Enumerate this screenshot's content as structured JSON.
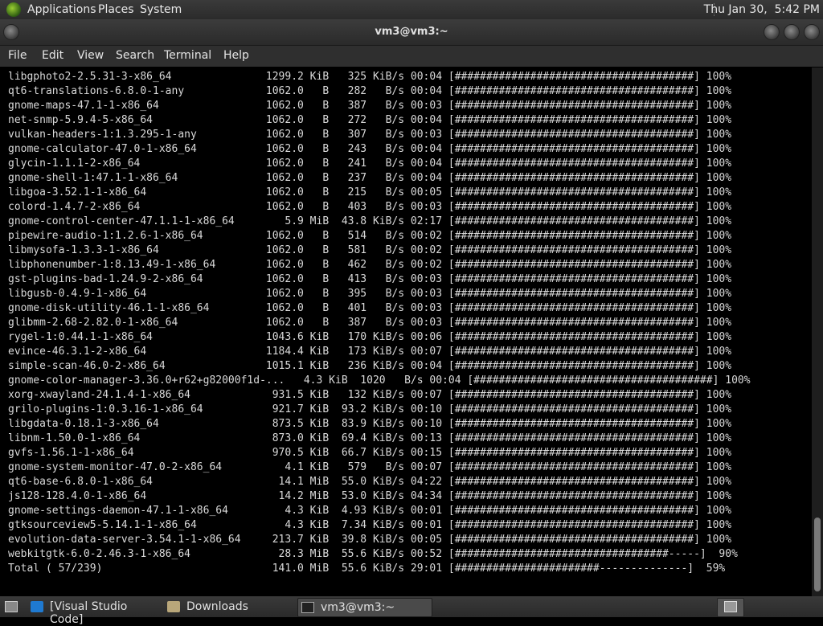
{
  "top_panel": {
    "menus": [
      "Applications",
      "Places",
      "System"
    ],
    "clock": "Thu Jan 30,  5:42 PM"
  },
  "window": {
    "title": "vm3@vm3:~"
  },
  "menubar": [
    "File",
    "Edit",
    "View",
    "Search",
    "Terminal",
    "Help"
  ],
  "terminal_lines": [
    "libgphoto2-2.5.31-3-x86_64               1299.2 KiB   325 KiB/s 00:04 [######################################] 100%",
    "qt6-translations-6.8.0-1-any             1062.0   B   282   B/s 00:04 [######################################] 100%",
    "gnome-maps-47.1-1-x86_64                 1062.0   B   387   B/s 00:03 [######################################] 100%",
    "net-snmp-5.9.4-5-x86_64                  1062.0   B   272   B/s 00:04 [######################################] 100%",
    "vulkan-headers-1:1.3.295-1-any           1062.0   B   307   B/s 00:03 [######################################] 100%",
    "gnome-calculator-47.0-1-x86_64           1062.0   B   243   B/s 00:04 [######################################] 100%",
    "glycin-1.1.1-2-x86_64                    1062.0   B   241   B/s 00:04 [######################################] 100%",
    "gnome-shell-1:47.1-1-x86_64              1062.0   B   237   B/s 00:04 [######################################] 100%",
    "libgoa-3.52.1-1-x86_64                   1062.0   B   215   B/s 00:05 [######################################] 100%",
    "colord-1.4.7-2-x86_64                    1062.0   B   403   B/s 00:03 [######################################] 100%",
    "gnome-control-center-47.1.1-1-x86_64        5.9 MiB  43.8 KiB/s 02:17 [######################################] 100%",
    "pipewire-audio-1:1.2.6-1-x86_64          1062.0   B   514   B/s 00:02 [######################################] 100%",
    "libmysofa-1.3.3-1-x86_64                 1062.0   B   581   B/s 00:02 [######################################] 100%",
    "libphonenumber-1:8.13.49-1-x86_64        1062.0   B   462   B/s 00:02 [######################################] 100%",
    "gst-plugins-bad-1.24.9-2-x86_64          1062.0   B   413   B/s 00:03 [######################################] 100%",
    "libgusb-0.4.9-1-x86_64                   1062.0   B   395   B/s 00:03 [######################################] 100%",
    "gnome-disk-utility-46.1-1-x86_64         1062.0   B   401   B/s 00:03 [######################################] 100%",
    "glibmm-2.68-2.82.0-1-x86_64              1062.0   B   387   B/s 00:03 [######################################] 100%",
    "rygel-1:0.44.1-1-x86_64                  1043.6 KiB   170 KiB/s 00:06 [######################################] 100%",
    "evince-46.3.1-2-x86_64                   1184.4 KiB   173 KiB/s 00:07 [######################################] 100%",
    "simple-scan-46.0-2-x86_64                1015.1 KiB   236 KiB/s 00:04 [######################################] 100%",
    "gnome-color-manager-3.36.0+r62+g82000f1d-...   4.3 KiB  1020   B/s 00:04 [######################################] 100%",
    "xorg-xwayland-24.1.4-1-x86_64             931.5 KiB   132 KiB/s 00:07 [######################################] 100%",
    "grilo-plugins-1:0.3.16-1-x86_64           921.7 KiB  93.2 KiB/s 00:10 [######################################] 100%",
    "libgdata-0.18.1-3-x86_64                  873.5 KiB  83.9 KiB/s 00:10 [######################################] 100%",
    "libnm-1.50.0-1-x86_64                     873.0 KiB  69.4 KiB/s 00:13 [######################################] 100%",
    "gvfs-1.56.1-1-x86_64                      970.5 KiB  66.7 KiB/s 00:15 [######################################] 100%",
    "gnome-system-monitor-47.0-2-x86_64          4.1 KiB   579   B/s 00:07 [######################################] 100%",
    "qt6-base-6.8.0-1-x86_64                    14.1 MiB  55.0 KiB/s 04:22 [######################################] 100%",
    "js128-128.4.0-1-x86_64                     14.2 MiB  53.0 KiB/s 04:34 [######################################] 100%",
    "gnome-settings-daemon-47.1-1-x86_64         4.3 KiB  4.93 KiB/s 00:01 [######################################] 100%",
    "gtksourceview5-5.14.1-1-x86_64              4.3 KiB  7.34 KiB/s 00:01 [######################################] 100%",
    "evolution-data-server-3.54.1-1-x86_64     213.7 KiB  39.8 KiB/s 00:05 [######################################] 100%",
    "webkitgtk-6.0-2.46.3-1-x86_64              28.3 MiB  55.6 KiB/s 00:52 [##################################-----]  90%",
    "Total ( 57/239)                           141.0 MiB  55.6 KiB/s 29:01 [#######################--------------]  59%"
  ],
  "taskbar": [
    {
      "label": "[Visual Studio Code]",
      "icon": "vscode-icon",
      "active": false
    },
    {
      "label": "Downloads",
      "icon": "folder-icon",
      "active": false
    },
    {
      "label": "vm3@vm3:~",
      "icon": "terminal-icon",
      "active": true
    }
  ],
  "colors": {
    "panel": "#2f2f2f",
    "terminal_bg": "#000000",
    "terminal_fg": "#d9d9d9"
  }
}
